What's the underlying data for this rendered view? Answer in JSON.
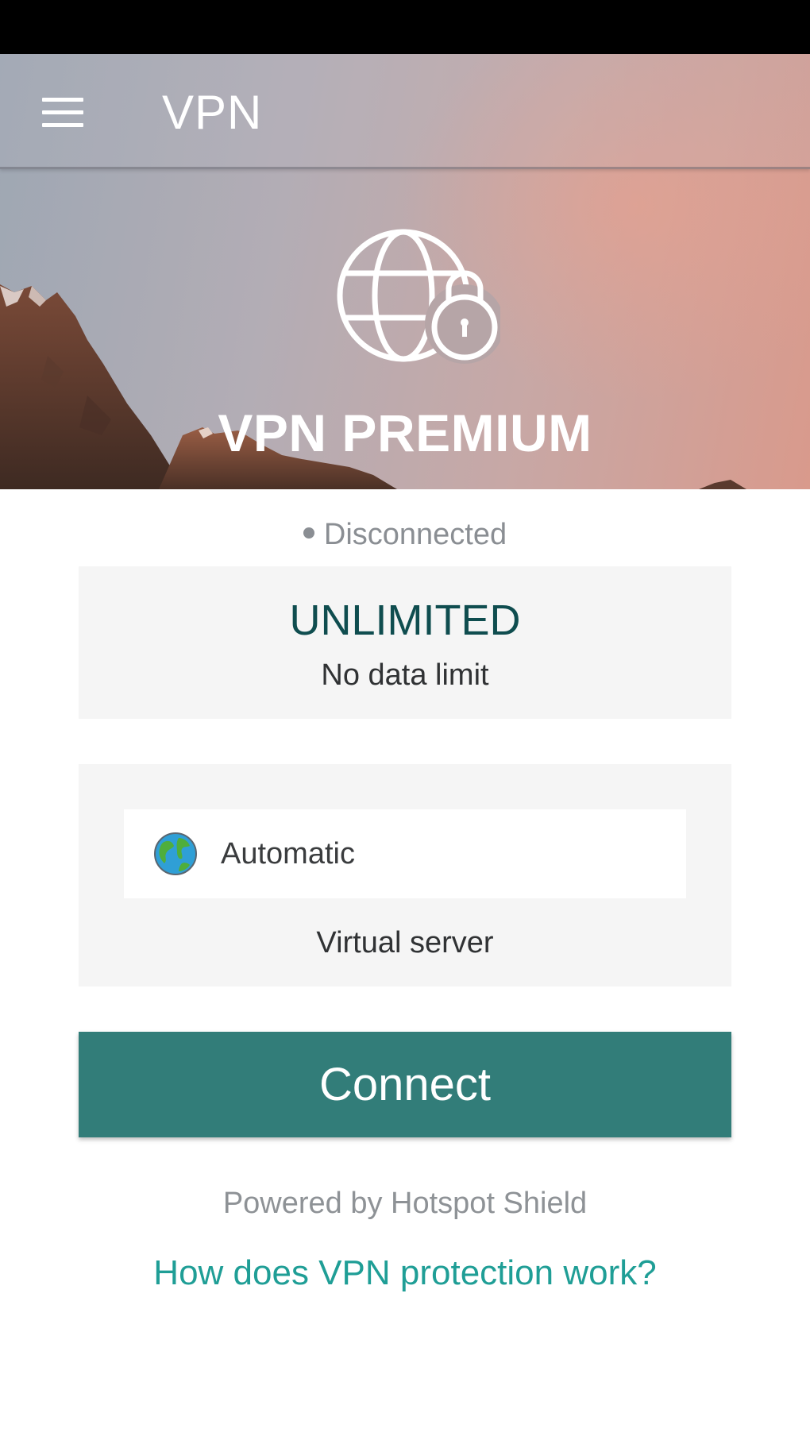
{
  "app_bar": {
    "title": "VPN",
    "menu_icon": "hamburger-menu-icon"
  },
  "hero": {
    "icon": "globe-lock-icon",
    "title": "VPN PREMIUM"
  },
  "connection": {
    "status": "Disconnected"
  },
  "data_plan": {
    "title": "UNLIMITED",
    "subtitle": "No data limit"
  },
  "server": {
    "location": "Automatic",
    "location_icon": "earth-globe-icon",
    "label": "Virtual server"
  },
  "connect_button": {
    "label": "Connect"
  },
  "footer": {
    "powered_by": "Powered by Hotspot Shield",
    "help_link": "How does VPN protection work?"
  },
  "colors": {
    "accent": "#327d79",
    "plan_text": "#0f4d4f",
    "link": "#1f9e96",
    "status_text": "#8a8e93"
  }
}
